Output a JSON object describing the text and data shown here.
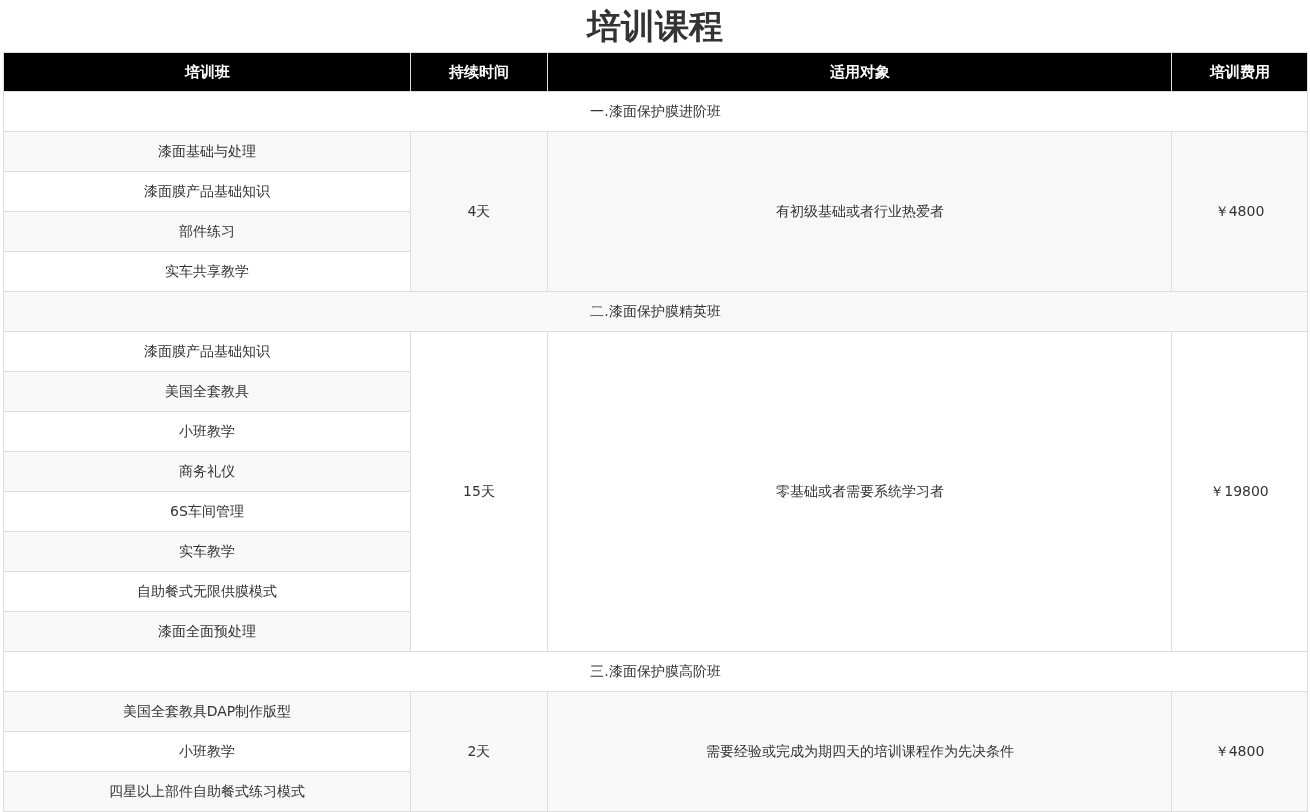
{
  "title": "培训课程",
  "columns": [
    "培训班",
    "持续时间",
    "适用对象",
    "培训费用"
  ],
  "sections": [
    {
      "title": "一.漆面保护膜进阶班",
      "items": [
        "漆面基础与处理",
        "漆面膜产品基础知识",
        "部件练习",
        "实车共享教学"
      ],
      "duration": "4天",
      "audience": "有初级基础或者行业热爱者",
      "fee": "￥4800"
    },
    {
      "title": "二.漆面保护膜精英班",
      "items": [
        "漆面膜产品基础知识",
        "美国全套教具",
        "小班教学",
        "商务礼仪",
        "6S车间管理",
        "实车教学",
        "自助餐式无限供膜模式",
        "漆面全面预处理"
      ],
      "duration": "15天",
      "audience": "零基础或者需要系统学习者",
      "fee": "￥19800"
    },
    {
      "title": "三.漆面保护膜高阶班",
      "items": [
        "美国全套教具DAP制作版型",
        "小班教学",
        "四星以上部件自助餐式练习模式"
      ],
      "duration": "2天",
      "audience": "需要经验或完成为期四天的培训课程作为先决条件",
      "fee": "￥4800"
    }
  ]
}
